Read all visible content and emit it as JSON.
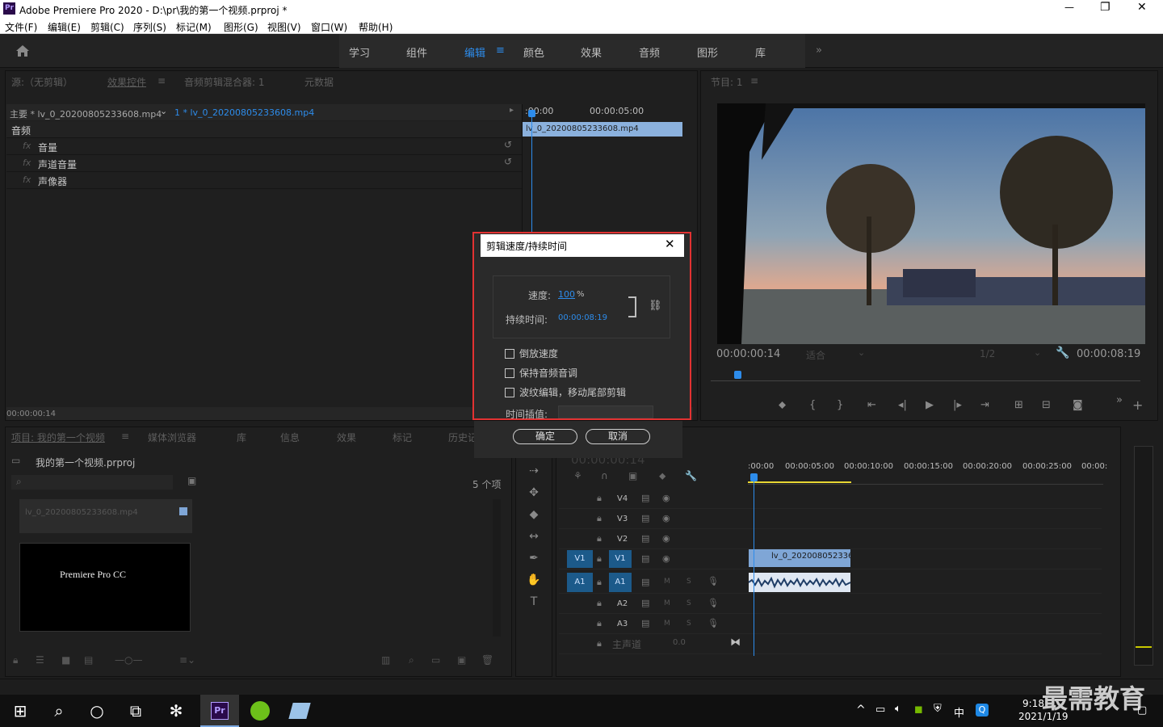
{
  "window": {
    "title": "Adobe Premiere Pro 2020 - D:\\pr\\我的第一个视频.prproj *",
    "app_icon": "Pr",
    "controls": [
      "—",
      "❐",
      "✕"
    ]
  },
  "menu": [
    "文件(F)",
    "编辑(E)",
    "剪辑(C)",
    "序列(S)",
    "标记(M)",
    "图形(G)",
    "视图(V)",
    "窗口(W)",
    "帮助(H)"
  ],
  "workspaces": [
    "学习",
    "组件",
    "编辑",
    "颜色",
    "效果",
    "音频",
    "图形",
    "库"
  ],
  "workspace_more": "»",
  "source_panel": {
    "tabs": [
      "源:（无剪辑）",
      "效果控件",
      "音频剪辑混合器: 1",
      "元数据"
    ],
    "master_label": "主要 * lv_0_20200805233608.mp4",
    "clip_label": "1 * lv_0_20200805233608.mp4",
    "ruler": [
      ":00:00",
      "00:00:05:00"
    ],
    "clip_bar": "lv_0_20200805233608.mp4",
    "section": "音频",
    "effects": [
      {
        "fx": "fx",
        "name": "音量"
      },
      {
        "fx": "fx",
        "name": "声道音量"
      },
      {
        "fx": "fx",
        "name": "声像器"
      }
    ],
    "timecode": "00:00:00:14"
  },
  "program_panel": {
    "tab": "节目: 1",
    "timecode_left": "00:00:00:14",
    "fit": "适合",
    "resolution": "1/2",
    "timecode_right": "00:00:08:19"
  },
  "dialog": {
    "title": "剪辑速度/持续时间",
    "speed_label": "速度:",
    "speed_value": "100",
    "speed_unit": "%",
    "duration_label": "持续时间:",
    "duration_value": "00:00:08:19",
    "options": [
      "倒放速度",
      "保持音频音调",
      "波纹编辑，移动尾部剪辑"
    ],
    "interp_label": "时间插值:",
    "ok": "确定",
    "cancel": "取消"
  },
  "project_panel": {
    "tabs": [
      "项目: 我的第一个视频",
      "媒体浏览器",
      "库",
      "信息",
      "效果",
      "标记",
      "历史记"
    ],
    "project_name": "我的第一个视频.prproj",
    "item_count": "5 个项",
    "items": [
      {
        "name": "lv_0_20200805233608.mp4"
      },
      {
        "name": "Premiere Pro CC"
      }
    ]
  },
  "timeline": {
    "timecode": "00:00:00:14",
    "ruler": [
      ":00:00",
      "00:00:05:00",
      "00:00:10:00",
      "00:00:15:00",
      "00:00:20:00",
      "00:00:25:00",
      "00:00:"
    ],
    "video_tracks": [
      "V4",
      "V3",
      "V2",
      "V1"
    ],
    "audio_tracks": [
      "A1",
      "A2",
      "A3"
    ],
    "source_v": "V1",
    "source_a": "A1",
    "master_label": "主声道",
    "master_value": "0.0",
    "clip_video": "lv_0_20200805233608.",
    "track_buttons": {
      "mute": "M",
      "solo": "S"
    }
  },
  "taskbar": {
    "time": "9:18",
    "date": "2021/1/19",
    "ime": "中",
    "watermark": "最需教育"
  },
  "colors": {
    "accent": "#2d8ceb",
    "dialog_border": "#e23232",
    "clip": "#7fa6d6"
  }
}
